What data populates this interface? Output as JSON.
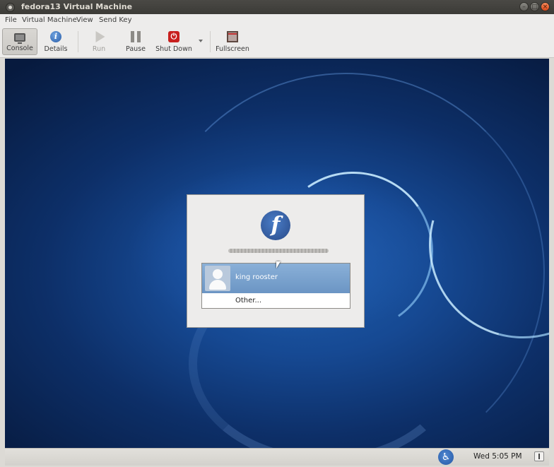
{
  "window": {
    "title": "fedora13 Virtual Machine"
  },
  "menubar": {
    "items": [
      "File",
      "Virtual Machine",
      "View",
      "Send Key"
    ]
  },
  "toolbar": {
    "console": "Console",
    "details": "Details",
    "run": "Run",
    "pause": "Pause",
    "shutdown": "Shut Down",
    "fullscreen": "Fullscreen"
  },
  "login": {
    "users": [
      {
        "name": "king rooster"
      }
    ],
    "other": "Other..."
  },
  "panel": {
    "clock": "Wed  5:05 PM"
  }
}
